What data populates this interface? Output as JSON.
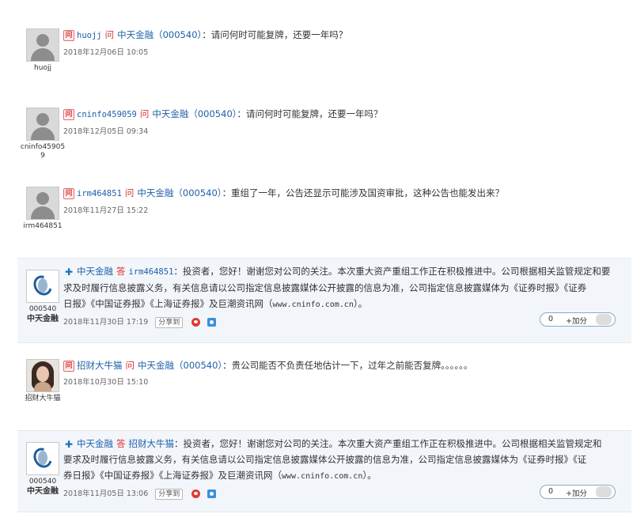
{
  "entries": [
    {
      "type": "question",
      "user_name": "huojj",
      "user_display": "huojj",
      "kw": "问",
      "company": "中天金融",
      "code": "（000540）",
      "text": "：请问何时可能复牌，还要一年吗？",
      "time": "2018年12月06日 10:05"
    },
    {
      "type": "question",
      "user_name": "cninfo459059",
      "user_display": "cninfo459059",
      "kw": "问",
      "company": "中天金融",
      "code": "（000540）",
      "text": "：请问何时可能复牌，还要一年吗？",
      "time": "2018年12月05日 09:34"
    },
    {
      "type": "question",
      "user_name": "irm464851",
      "user_display": "irm464851",
      "kw": "问",
      "company": "中天金融",
      "code": "（000540）",
      "text": "：重组了一年，公告还显示可能涉及国资审批，这种公告也能发出来？",
      "time": "2018年11月27日 15:22"
    },
    {
      "type": "answer",
      "avatar_code": "000540",
      "avatar_company": "中天金融",
      "company": "中天金融",
      "kw": "答",
      "target": "irm464851",
      "line1": "：投资者，您好！谢谢您对公司的关注。本次重大资产重组工作正在积极推进中。公司根据相关监管规定和要",
      "line2": "求及时履行信息披露义务，有关信息请以公司指定信息披露媒体公开披露的信息为准，公司指定信息披露媒体为《证券时报》《证券",
      "line3a": "日报》《中国证券报》《上海证券报》及巨潮资讯网（",
      "url": "www.cninfo.com.cn",
      "line3b": "）。",
      "time": "2018年11月30日 17:19",
      "share": "分享到",
      "like_count": "0",
      "like_plus": "+加分"
    },
    {
      "type": "question",
      "user_name": "招财大牛猫",
      "user_display": "招财大牛猫",
      "kw": "问",
      "company": "中天金融",
      "code": "（000540）",
      "text": "：贵公司能否不负责任地估计一下，过年之前能否复牌。。。。。。",
      "time": "2018年10月30日 15:10"
    },
    {
      "type": "answer",
      "avatar_code": "000540",
      "avatar_company": "中天金融",
      "company": "中天金融",
      "kw": "答",
      "target": "招财大牛猫",
      "line1": "：投资者，您好！谢谢您对公司的关注。本次重大资产重组工作正在积极推进中。公司根据相关监管规定和",
      "line2": "要求及时履行信息披露义务，有关信息请以公司指定信息披露媒体公开披露的信息为准，公司指定信息披露媒体为《证券时报》《证",
      "line3a": "券日报》《中国证券报》《上海证券报》及巨潮资讯网（",
      "url": "www.cninfo.com.cn",
      "line3b": "）。",
      "time": "2018年11月05日 13:06",
      "share": "分享到",
      "like_count": "0",
      "like_plus": "+加分"
    }
  ]
}
